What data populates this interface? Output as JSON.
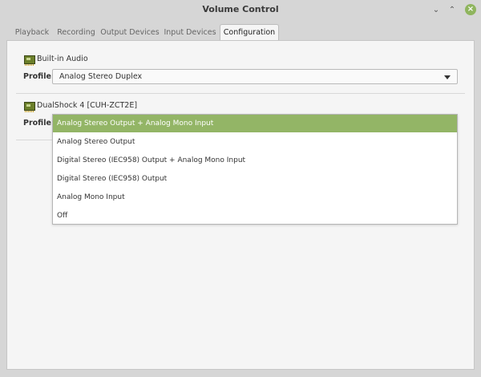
{
  "window": {
    "title": "Volume Control",
    "minimize_glyph": "⌄",
    "maximize_glyph": "⌃",
    "close_glyph": "×",
    "close_color": "#8fb55e"
  },
  "tabs": [
    {
      "label": "Playback"
    },
    {
      "label": "Recording"
    },
    {
      "label": "Output Devices"
    },
    {
      "label": "Input Devices"
    },
    {
      "label": "Configuration",
      "active": true
    }
  ],
  "devices": [
    {
      "icon": "sound-card-icon",
      "name": "Built-in Audio",
      "profile_label": "Profile:",
      "profile_value": "Analog Stereo Duplex"
    },
    {
      "icon": "sound-card-icon",
      "name": "DualShock 4 [CUH-ZCT2E]",
      "profile_label": "Profile:"
    }
  ],
  "dropdown": {
    "selected_color": "#93b566",
    "options": [
      {
        "label": "Analog Stereo Output + Analog Mono Input",
        "selected": true
      },
      {
        "label": "Analog Stereo Output"
      },
      {
        "label": "Digital Stereo (IEC958) Output + Analog Mono Input"
      },
      {
        "label": "Digital Stereo (IEC958) Output"
      },
      {
        "label": "Analog Mono Input"
      },
      {
        "label": "Off"
      }
    ]
  }
}
